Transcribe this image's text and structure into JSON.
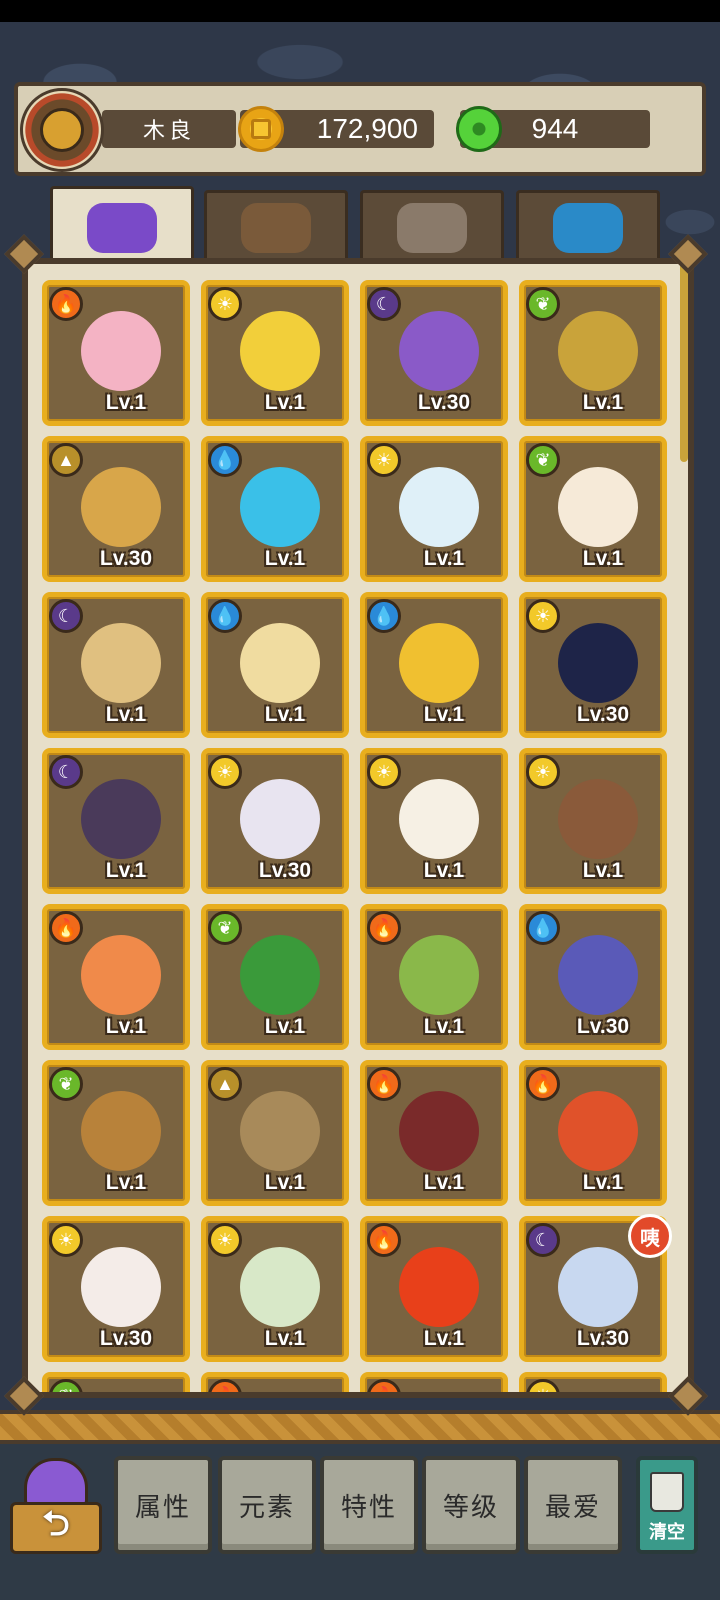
{
  "header": {
    "player_name": "木良",
    "coins": "172,900",
    "gems": "944"
  },
  "tabs": [
    {
      "icon": "monster-icon",
      "active": true
    },
    {
      "icon": "gear-feather-icon",
      "active": false
    },
    {
      "icon": "food-bowl-icon",
      "active": false
    },
    {
      "icon": "crystal-icon",
      "active": false
    }
  ],
  "pets": [
    {
      "element": "fire",
      "level": "Lv.1",
      "color": "#f4b3c4"
    },
    {
      "element": "sun",
      "level": "Lv.1",
      "color": "#f2cf3a"
    },
    {
      "element": "moon",
      "level": "Lv.30",
      "color": "#8a5ac8"
    },
    {
      "element": "leaf",
      "level": "Lv.1",
      "color": "#c9a33a"
    },
    {
      "element": "earth",
      "level": "Lv.30",
      "color": "#d8a64a"
    },
    {
      "element": "water",
      "level": "Lv.1",
      "color": "#3ac0e8"
    },
    {
      "element": "sun",
      "level": "Lv.1",
      "color": "#dff0f8"
    },
    {
      "element": "leaf",
      "level": "Lv.1",
      "color": "#f6ead8"
    },
    {
      "element": "moon",
      "level": "Lv.1",
      "color": "#e0c080"
    },
    {
      "element": "water",
      "level": "Lv.1",
      "color": "#f0dca0"
    },
    {
      "element": "water",
      "level": "Lv.1",
      "color": "#f0c030"
    },
    {
      "element": "sun",
      "level": "Lv.30",
      "color": "#1e2448"
    },
    {
      "element": "moon",
      "level": "Lv.1",
      "color": "#4a3a5a"
    },
    {
      "element": "sun",
      "level": "Lv.30",
      "color": "#e8e4f0"
    },
    {
      "element": "sun",
      "level": "Lv.1",
      "color": "#f6f0e4"
    },
    {
      "element": "sun",
      "level": "Lv.1",
      "color": "#8a5a3a"
    },
    {
      "element": "fire",
      "level": "Lv.1",
      "color": "#f08a4a"
    },
    {
      "element": "leaf",
      "level": "Lv.1",
      "color": "#3a9a3a"
    },
    {
      "element": "fire",
      "level": "Lv.1",
      "color": "#8ab84a"
    },
    {
      "element": "water",
      "level": "Lv.30",
      "color": "#5a5ab8"
    },
    {
      "element": "leaf",
      "level": "Lv.1",
      "color": "#b8823a"
    },
    {
      "element": "earth",
      "level": "Lv.1",
      "color": "#a88a5a"
    },
    {
      "element": "fire",
      "level": "Lv.1",
      "color": "#7a2a2a"
    },
    {
      "element": "fire",
      "level": "Lv.1",
      "color": "#e0522a"
    },
    {
      "element": "sun",
      "level": "Lv.30",
      "color": "#f4ece8"
    },
    {
      "element": "sun",
      "level": "Lv.1",
      "color": "#d8e8c8"
    },
    {
      "element": "fire",
      "level": "Lv.1",
      "color": "#e8401a"
    },
    {
      "element": "moon",
      "level": "Lv.30",
      "color": "#c8d8f0"
    },
    {
      "element": "leaf",
      "level": "",
      "color": "#7a6340"
    },
    {
      "element": "fire",
      "level": "",
      "color": "#7a6340"
    },
    {
      "element": "fire",
      "level": "",
      "color": "#7a6340"
    },
    {
      "element": "sun",
      "level": "",
      "color": "#7a6340"
    }
  ],
  "badge": "咦",
  "bottom": {
    "back_label": "⮌",
    "filters": [
      "属性",
      "元素",
      "特性",
      "等级",
      "最爱"
    ],
    "clear_label": "清空"
  }
}
